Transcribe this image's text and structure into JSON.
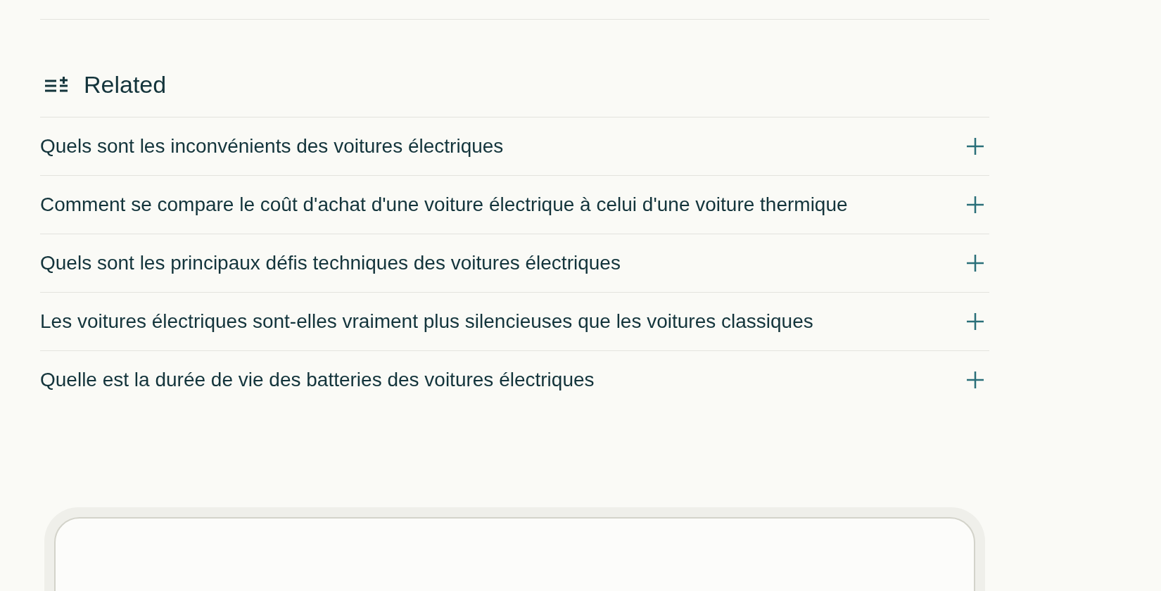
{
  "related": {
    "title": "Related",
    "items": [
      {
        "question": "Quels sont les inconvénients des voitures électriques"
      },
      {
        "question": "Comment se compare le coût d'achat d'une voiture électrique à celui d'une voiture thermique"
      },
      {
        "question": "Quels sont les principaux défis techniques des voitures électriques"
      },
      {
        "question": "Les voitures électriques sont-elles vraiment plus silencieuses que les voitures classiques"
      },
      {
        "question": "Quelle est la durée de vie des batteries des voitures électriques"
      }
    ]
  }
}
